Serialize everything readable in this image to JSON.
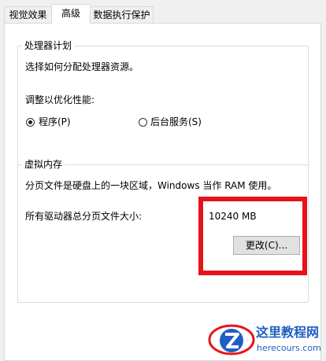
{
  "tabs": [
    {
      "label": "视觉效果"
    },
    {
      "label": "高级"
    },
    {
      "label": "数据执行保护"
    }
  ],
  "processor": {
    "legend": "处理器计划",
    "description": "选择如何分配处理器资源。",
    "adjust_label": "调整以优化性能:",
    "options": [
      {
        "label": "程序(P)",
        "checked": true
      },
      {
        "label": "后台服务(S)",
        "checked": false
      }
    ]
  },
  "virtual_memory": {
    "legend": "虚拟内存",
    "description": "分页文件是硬盘上的一块区域，Windows 当作 RAM 使用。",
    "total_label": "所有驱动器总分页文件大小:",
    "total_value": "10240 MB",
    "change_button": "更改(C)..."
  },
  "highlight_color": "#e8131a",
  "watermark": {
    "name": "这里教程网",
    "url": "herecours.com"
  }
}
